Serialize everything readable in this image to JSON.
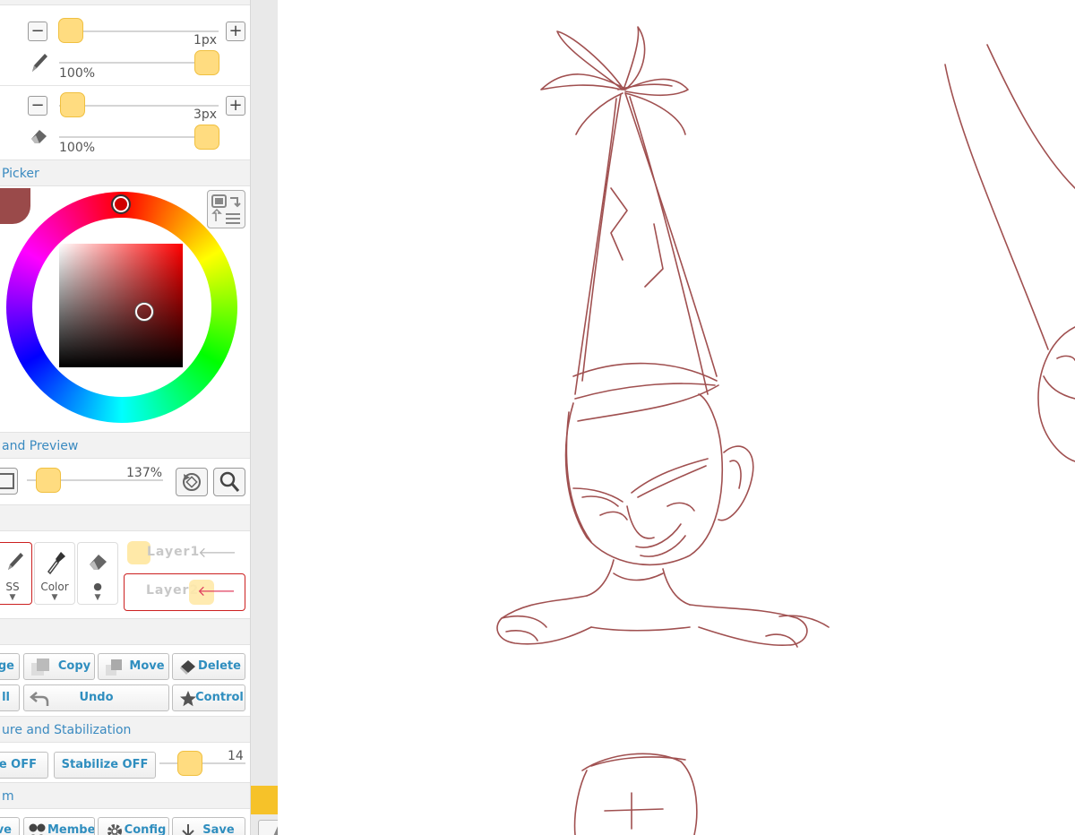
{
  "brush": {
    "size_value": "1px",
    "opacity_value": "100%"
  },
  "eraser": {
    "size_value": "3px",
    "opacity_value": "100%"
  },
  "color_picker": {
    "title": "Picker",
    "current_color": "#9a4a4a"
  },
  "preview": {
    "title": "and Preview",
    "zoom_value": "137%"
  },
  "tools": {
    "pen_label": "SS",
    "dropper_label": "Color",
    "eraser_label": "●"
  },
  "layers": {
    "layer1_name": "Layer1",
    "layer2_name": "Layer2"
  },
  "actions": {
    "merge_label": "rge",
    "copy_label": "Copy",
    "move_label": "Move",
    "delete_label": "Delete",
    "fill_label": "ll",
    "undo_label": "Undo",
    "control_label": "Control"
  },
  "stabilization": {
    "title": "ure and Stabilization",
    "pressure_label": "re OFF",
    "stabilize_label": "Stabilize OFF",
    "stabilize_value": "14"
  },
  "bottom_section": {
    "title": "m",
    "save_left_label": "ve",
    "member_label": "Member",
    "config_label": "Config",
    "save_label": "Save"
  },
  "colors": {
    "accent_text": "#2f8ebf",
    "knob_fill": "#ffdc80",
    "sketch_stroke": "#a05050",
    "selected_border": "#cc2020",
    "layer_arrow_active": "#e04060"
  }
}
